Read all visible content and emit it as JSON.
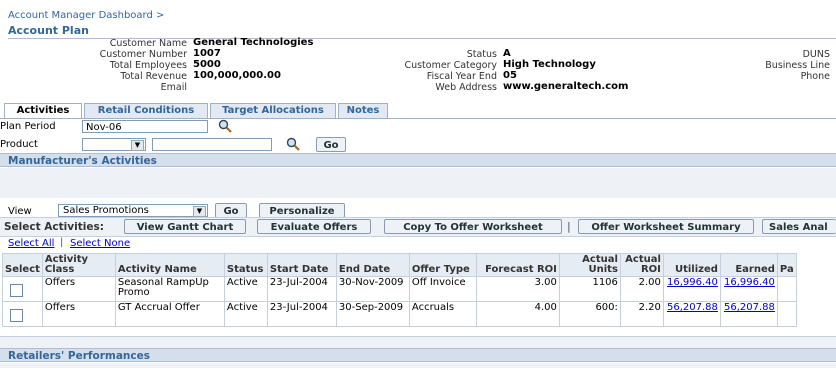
{
  "breadcrumb": "Account Manager Dashboard >",
  "page_title": "Account Plan",
  "customer": {
    "name_label": "Customer Name",
    "name_value": "General Technologies",
    "number_label": "Customer Number",
    "number_value": "1007",
    "employees_label": "Total Employees",
    "employees_value": "5000",
    "revenue_label": "Total Revenue",
    "revenue_value": "100,000,000.00",
    "email_label": "Email",
    "status_label": "Status",
    "status_value": "A",
    "category_label": "Customer Category",
    "category_value": "High Technology",
    "fiscal_label": "Fiscal Year End",
    "fiscal_value": "05",
    "web_label": "Web Address",
    "web_value": "www.generaltech.com",
    "duns_label": "DUNS",
    "business_line_label": "Business Line",
    "phone_label": "Phone"
  },
  "tabs": [
    "Activities",
    "Retail Conditions",
    "Target Allocations",
    "Notes"
  ],
  "filters": {
    "plan_period_label": "Plan Period",
    "plan_period_value": "Nov-06",
    "product_label": "Product",
    "go_label": "Go"
  },
  "manufacturer_section": "Manufacturer's Activities",
  "view": {
    "label": "View",
    "selected": "Sales Promotions",
    "go_label": "Go",
    "personalize_label": "Personalize"
  },
  "select_activities": {
    "label": "Select Activities:",
    "buttons": [
      "View Gantt Chart",
      "Evaluate Offers",
      "Copy To Offer Worksheet",
      "Offer Worksheet Summary",
      "Sales Anal"
    ]
  },
  "select_all": "Select All",
  "select_none": "Select None",
  "table": {
    "headers": [
      "Select",
      "Activity Class",
      "Activity Name",
      "Status",
      "Start Date",
      "End Date",
      "Offer Type",
      "Forecast ROI",
      "Actual Units",
      "Actual ROI",
      "Utilized",
      "Earned",
      "Pa"
    ],
    "rows": [
      [
        "",
        "Offers",
        "Seasonal RampUp Promo",
        "Active",
        "23-Jul-2004",
        "30-Nov-2009",
        "Off Invoice",
        "3.00",
        "1106",
        "2.00",
        "16,996.40",
        "16,996.40",
        ""
      ],
      [
        "",
        "Offers",
        "GT Accrual Offer",
        "Active",
        "23-Jul-2004",
        "30-Sep-2009",
        "Accruals",
        "4.00",
        "600:",
        "2.20",
        "56,207.88",
        "56,207.88",
        ""
      ]
    ]
  },
  "retailers_section": "Retailers' Performances",
  "colors": {
    "header_blue": "#336699",
    "section_bg": "#d5dfeb",
    "link": "#0000cc"
  },
  "icons": [
    "search-icon",
    "chevron-down-icon",
    "checkbox-icon"
  ]
}
